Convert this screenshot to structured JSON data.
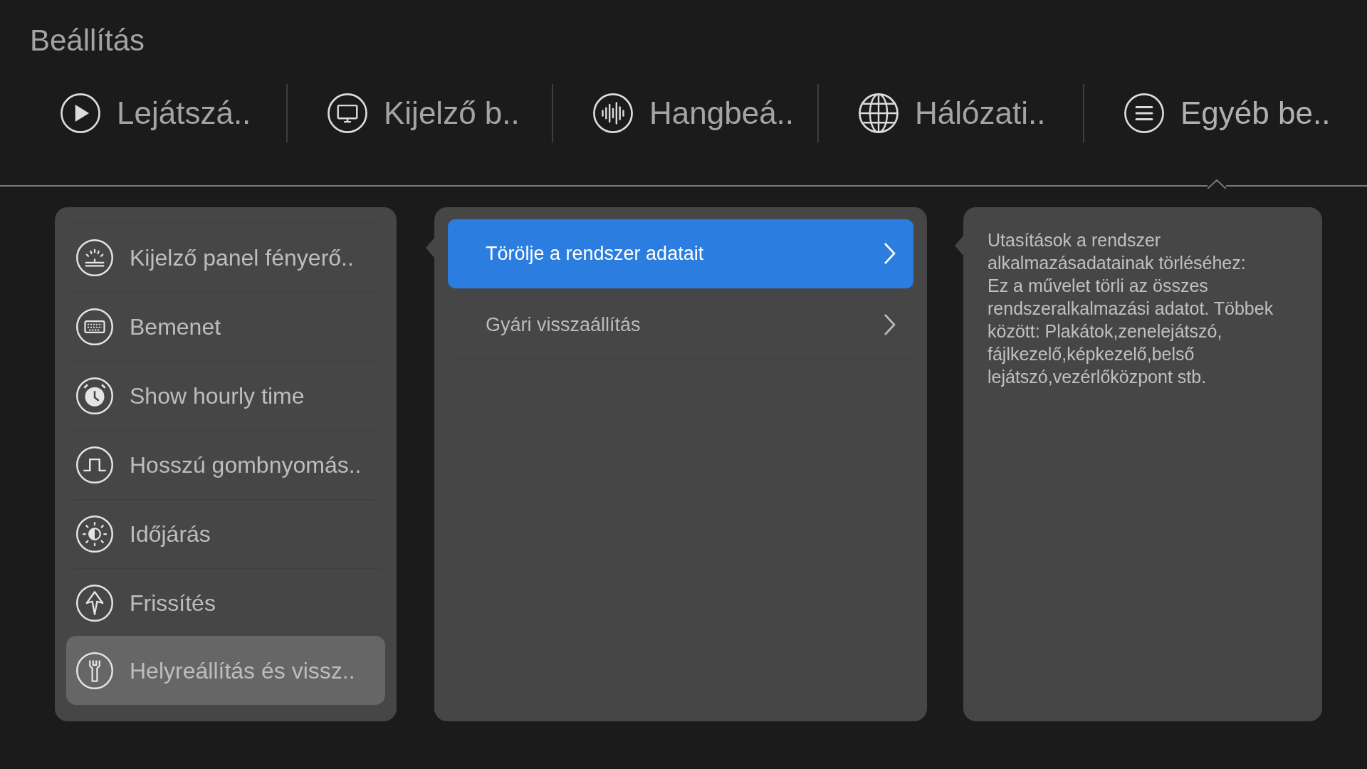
{
  "window": {
    "title": "Beállítás"
  },
  "tabs": [
    {
      "label": "Lejátszá..",
      "selected": false
    },
    {
      "label": "Kijelző b..",
      "selected": false
    },
    {
      "label": "Hangbeá..",
      "selected": false
    },
    {
      "label": "Hálózati..",
      "selected": false
    },
    {
      "label": "Egyéb be..",
      "selected": true
    }
  ],
  "sidebar": {
    "items": [
      {
        "label": "Kijelző panel fényerő..",
        "selected": false
      },
      {
        "label": "Bemenet",
        "selected": false
      },
      {
        "label": "Show hourly time",
        "selected": false
      },
      {
        "label": "Hosszú gombnyomás..",
        "selected": false
      },
      {
        "label": "Időjárás",
        "selected": false
      },
      {
        "label": "Frissítés",
        "selected": false
      },
      {
        "label": "Helyreállítás és vissz..",
        "selected": true
      }
    ]
  },
  "options": [
    {
      "label": "Törölje a rendszer adatait",
      "selected": true
    },
    {
      "label": "Gyári visszaállítás",
      "selected": false
    }
  ],
  "description": "Utasítások a rendszer alkalmazásadatainak törléséhez:\nEz a művelet törli az összes rendszeralkalmazási adatot. Többek között: Plakátok,zenelejátszó, fájlkezelő,képkezelő,belső lejátszó,vezérlőközpont stb."
}
